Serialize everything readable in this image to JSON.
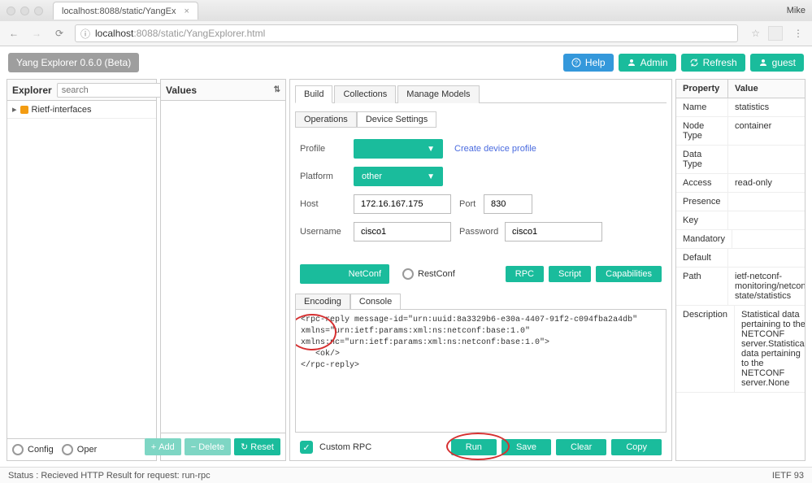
{
  "browser": {
    "tab_title": "localhost:8088/static/YangEx",
    "profile": "Mike",
    "url_host": "localhost",
    "url_port": ":8088",
    "url_path": "/static/YangExplorer.html"
  },
  "header": {
    "app_title": "Yang Explorer 0.6.0 (Beta)",
    "help": "Help",
    "admin": "Admin",
    "refresh": "Refresh",
    "guest": "guest"
  },
  "explorer": {
    "title": "Explorer",
    "search_placeholder": "search",
    "tree": {
      "item0": "Rietf-interfaces"
    },
    "footer": {
      "config": "Config",
      "oper": "Oper",
      "add": "Add",
      "delete": "Delete",
      "reset": "Reset"
    }
  },
  "values": {
    "title": "Values"
  },
  "center": {
    "tabs": {
      "build": "Build",
      "collections": "Collections",
      "manage": "Manage Models"
    },
    "subtabs": {
      "operations": "Operations",
      "device": "Device Settings"
    },
    "form": {
      "profile_lbl": "Profile",
      "create_profile": "Create device profile",
      "platform_lbl": "Platform",
      "platform_val": "other",
      "host_lbl": "Host",
      "host_val": "172.16.167.175",
      "port_lbl": "Port",
      "port_val": "830",
      "user_lbl": "Username",
      "user_val": "cisco1",
      "pass_lbl": "Password",
      "pass_val": "cisco1"
    },
    "protocol": {
      "netconf": "NetConf",
      "restconf": "RestConf",
      "rpc": "RPC",
      "script": "Script",
      "caps": "Capabilities"
    },
    "enc": {
      "encoding": "Encoding",
      "console": "Console"
    },
    "console_text": "<rpc-reply message-id=\"urn:uuid:8a3329b6-e30a-4407-91f2-c094fba2a4db\"\nxmlns=\"urn:ietf:params:xml:ns:netconf:base:1.0\"\nxmlns:nc=\"urn:ietf:params:xml:ns:netconf:base:1.0\">\n   <ok/>\n</rpc-reply>",
    "bottom": {
      "custom_rpc": "Custom RPC",
      "run": "Run",
      "save": "Save",
      "clear": "Clear",
      "copy": "Copy"
    }
  },
  "props": {
    "h_prop": "Property",
    "h_val": "Value",
    "rows": [
      {
        "p": "Name",
        "v": "statistics"
      },
      {
        "p": "Node Type",
        "v": "container"
      },
      {
        "p": "Data Type",
        "v": ""
      },
      {
        "p": "Access",
        "v": "read-only"
      },
      {
        "p": "Presence",
        "v": ""
      },
      {
        "p": "Key",
        "v": ""
      },
      {
        "p": "Mandatory",
        "v": ""
      },
      {
        "p": "Default",
        "v": ""
      },
      {
        "p": "Path",
        "v": "ietf-netconf-monitoring/netconf-state/statistics"
      },
      {
        "p": "Description",
        "v": "Statistical data pertaining to the NETCONF server.Statistical data pertaining to the NETCONF server.None"
      }
    ]
  },
  "status": {
    "left": "Status : Recieved HTTP Result for request: run-rpc",
    "right": "IETF 93"
  }
}
